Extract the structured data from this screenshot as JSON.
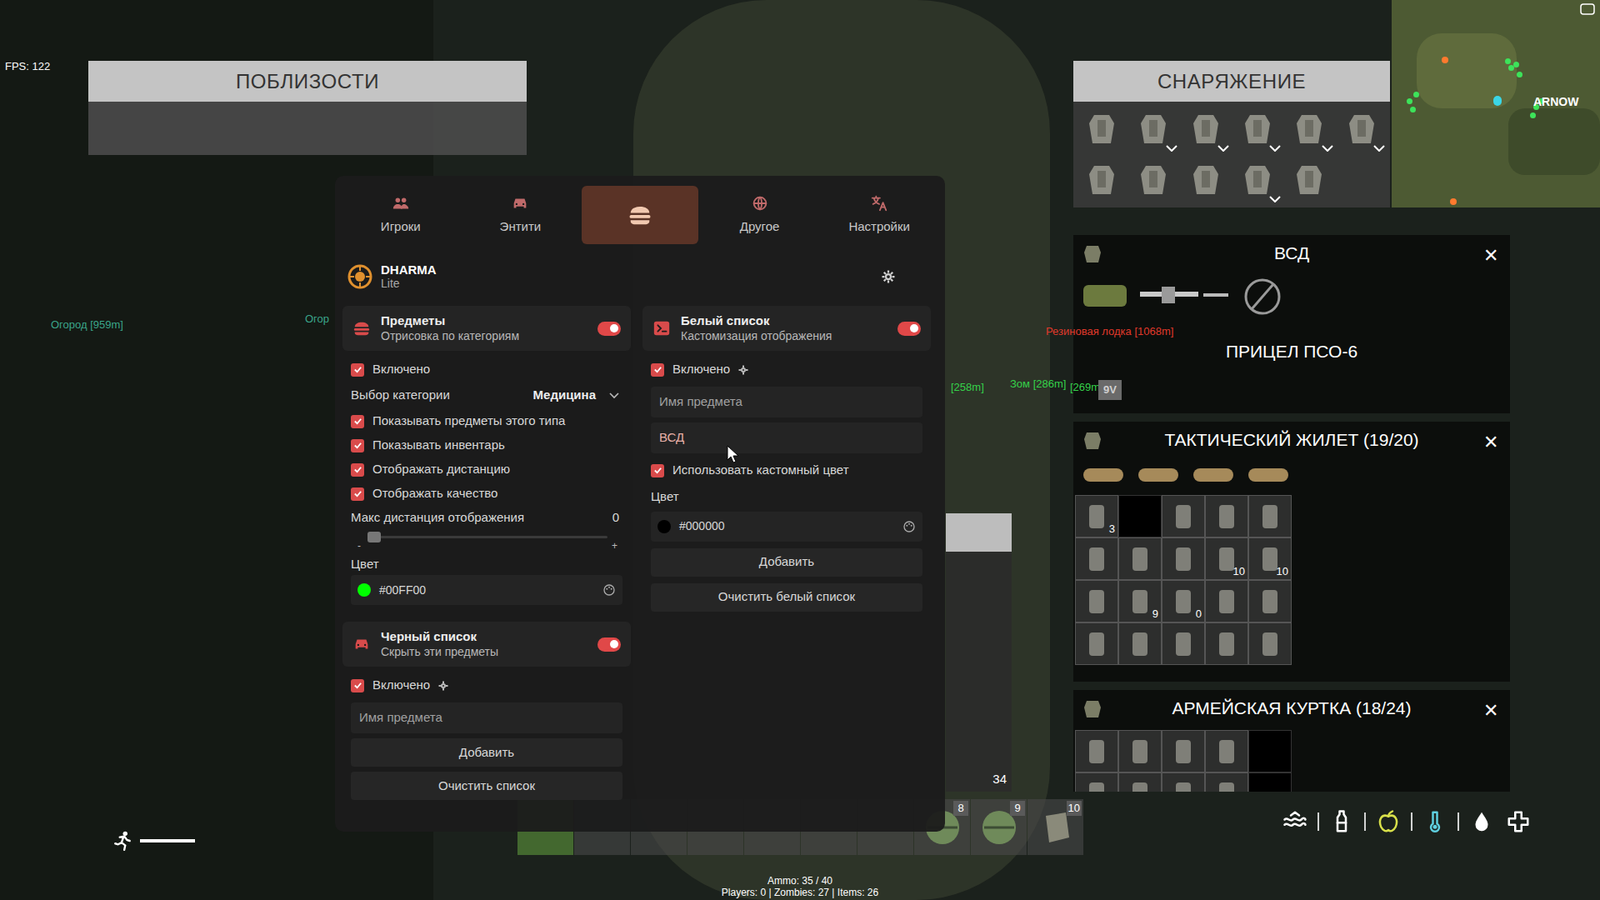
{
  "hud": {
    "fps": "FPS: 122",
    "ammo": "Ammo: 35 / 40",
    "stats": "Players: 0 | Zombies: 27 | Items: 26",
    "stamina": {
      "level": 1
    }
  },
  "world_labels": [
    {
      "text": "Огород [959m]",
      "color": "#3aa58a",
      "kind": "text"
    },
    {
      "text": "Огор",
      "color": "#3aa58a",
      "kind": "text"
    },
    {
      "text": "Резиновая лодка [1068m]",
      "color": "#e0392b",
      "kind": "text"
    },
    {
      "text": "[258m]",
      "color": "#35d24a",
      "kind": "text"
    },
    {
      "text": "Зом [286m]",
      "color": "#35d24a",
      "kind": "text"
    },
    {
      "text": "[269m]",
      "color": "#35d24a",
      "kind": "text"
    },
    {
      "text": "9V",
      "color": "#d0d0d0",
      "kind": "box"
    }
  ],
  "nearby": {
    "title": "ПОБЛИЗОСТИ"
  },
  "gear": {
    "title": "СНАРЯЖЕНИЕ",
    "slots": [
      {
        "expandable": false
      },
      {
        "expandable": true
      },
      {
        "expandable": true
      },
      {
        "expandable": true
      },
      {
        "expandable": true
      },
      {
        "expandable": true
      },
      {
        "expandable": false
      },
      {
        "expandable": false
      },
      {
        "expandable": false
      },
      {
        "expandable": true
      },
      {
        "expandable": false
      }
    ]
  },
  "minimap": {
    "label": "ARNOW"
  },
  "containers": [
    {
      "title": "ВСД",
      "close": "✕",
      "subtitle": "ПРИЦЕЛ ПСО-6",
      "kind": "weapon"
    },
    {
      "title": "ТАКТИЧЕСКИЙ ЖИЛЕТ (19/20)",
      "close": "✕",
      "kind": "grid",
      "attachments": [
        {
          "filled": true
        },
        {
          "filled": true
        },
        {
          "filled": true
        },
        {
          "filled": true
        }
      ],
      "cells": [
        {
          "filled": true,
          "count": "3"
        },
        {
          "filled": false,
          "count": ""
        },
        {
          "filled": true,
          "count": ""
        },
        {
          "filled": true,
          "count": ""
        },
        {
          "filled": true,
          "count": ""
        },
        {
          "filled": true,
          "count": ""
        },
        {
          "filled": true,
          "count": ""
        },
        {
          "filled": true,
          "count": ""
        },
        {
          "filled": true,
          "count": "10"
        },
        {
          "filled": true,
          "count": "10"
        },
        {
          "filled": true,
          "count": ""
        },
        {
          "filled": true,
          "count": "9"
        },
        {
          "filled": true,
          "count": "0"
        },
        {
          "filled": true,
          "count": ""
        },
        {
          "filled": true,
          "count": ""
        },
        {
          "filled": true,
          "count": ""
        },
        {
          "filled": true,
          "count": ""
        },
        {
          "filled": true,
          "count": ""
        },
        {
          "filled": true,
          "count": ""
        },
        {
          "filled": true,
          "count": ""
        }
      ]
    },
    {
      "title": "АРМЕЙСКАЯ КУРТКА (18/24)",
      "close": "✕",
      "kind": "grid",
      "attachments": [],
      "cells": [
        {
          "filled": true,
          "count": ""
        },
        {
          "filled": true,
          "count": ""
        },
        {
          "filled": true,
          "count": ""
        },
        {
          "filled": true,
          "count": ""
        },
        {
          "filled": false,
          "count": ""
        },
        {
          "filled": true,
          "count": ""
        },
        {
          "filled": true,
          "count": ""
        },
        {
          "filled": true,
          "count": ""
        },
        {
          "filled": true,
          "count": ""
        },
        {
          "filled": false,
          "count": ""
        }
      ]
    }
  ],
  "side_list": {
    "count": "34"
  },
  "hotbar": {
    "slots": [
      {
        "number": "",
        "selected": true,
        "kind": "empty"
      },
      {
        "number": "",
        "selected": false,
        "kind": "empty"
      },
      {
        "number": "",
        "selected": false,
        "kind": "empty"
      },
      {
        "number": "",
        "selected": false,
        "kind": "empty"
      },
      {
        "number": "",
        "selected": false,
        "kind": "empty"
      },
      {
        "number": "",
        "selected": false,
        "kind": "empty"
      },
      {
        "number": "",
        "selected": false,
        "kind": "empty"
      },
      {
        "number": "8",
        "selected": false,
        "kind": "grenade"
      },
      {
        "number": "9",
        "selected": false,
        "kind": "grenade"
      },
      {
        "number": "10",
        "selected": false,
        "kind": "item"
      }
    ]
  },
  "status_icons": [
    {
      "kind": "water",
      "color": "#ffffff"
    },
    {
      "kind": "bottle",
      "color": "#ffffff"
    },
    {
      "kind": "food",
      "color": "#d8e04a"
    },
    {
      "kind": "temperature",
      "color": "#5fd0e0"
    },
    {
      "kind": "blood",
      "color": "#ffffff"
    },
    {
      "kind": "health",
      "color": "#ffffff"
    }
  ],
  "menu": {
    "tabs": [
      {
        "label": "Игроки",
        "kind": "players",
        "selected": false
      },
      {
        "label": "Энтити",
        "kind": "car",
        "selected": false
      },
      {
        "kind": "burger",
        "selected": true
      },
      {
        "label": "Другое",
        "kind": "globe",
        "selected": false
      },
      {
        "label": "Настройки",
        "kind": "translate",
        "selected": false
      }
    ],
    "brand": {
      "name": "DHARMA",
      "edition": "Lite"
    },
    "items": {
      "title": "Предметы",
      "subtitle": "Отрисовка по категориям",
      "on": true,
      "enabled": {
        "label": "Включено",
        "checked": true
      },
      "category": {
        "label": "Выбор категории",
        "value": "Медицина"
      },
      "options": [
        {
          "label": "Показывать предметы этого типа",
          "checked": true
        },
        {
          "label": "Показывать инвентарь",
          "checked": true
        },
        {
          "label": "Отображать дистанцию",
          "checked": true
        },
        {
          "label": "Отображать качество",
          "checked": true
        }
      ],
      "max_distance": {
        "label": "Макс дистанция отображения",
        "value": "0",
        "level": 0,
        "minus": "-",
        "plus": "+"
      },
      "color": {
        "label": "Цвет",
        "value": "#00FF00",
        "swatch": "#00ff00"
      }
    },
    "blacklist": {
      "title": "Черный список",
      "subtitle": "Скрыть эти предметы",
      "on": true,
      "enabled": {
        "label": "Включено",
        "checked": true
      },
      "input": {
        "placeholder": "Имя предмета"
      },
      "add": "Добавить",
      "clear": "Очистить список"
    },
    "whitelist": {
      "title": "Белый список",
      "subtitle": "Кастомизация отображения",
      "on": true,
      "enabled": {
        "label": "Включено",
        "checked": true
      },
      "name_input": {
        "placeholder": "Имя предмета"
      },
      "value_input": {
        "value": "ВСД"
      },
      "custom_color": {
        "label": "Использовать кастомный цвет",
        "checked": true
      },
      "color": {
        "label": "Цвет",
        "value": "#000000",
        "swatch": "#000000"
      },
      "add": "Добавить",
      "clear": "Очистить белый список"
    }
  }
}
